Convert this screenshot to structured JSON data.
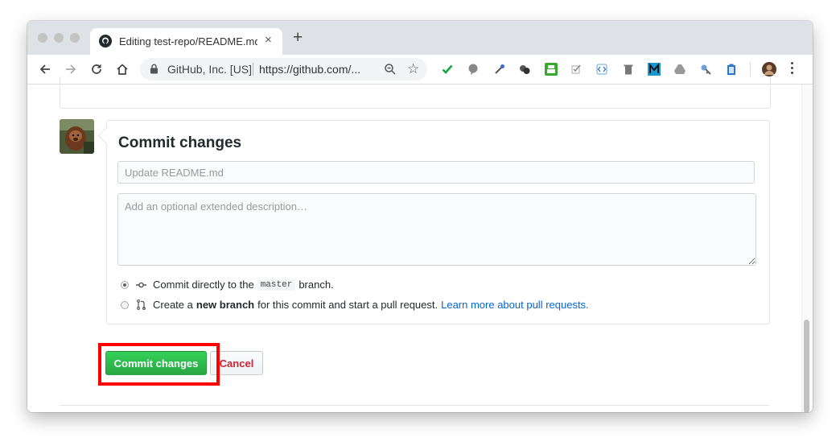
{
  "browser": {
    "tab_title": "Editing test-repo/README.md",
    "close_tab": "×",
    "new_tab": "+",
    "site_identity": "GitHub, Inc. [US]",
    "url": "https://github.com/...",
    "extensions": [
      "check-icon",
      "bubble-icon",
      "eyedropper-icon",
      "circles-icon",
      "printer-icon",
      "checkbox-icon",
      "code-icon",
      "trash-icon",
      "m-icon",
      "drive-icon",
      "key-icon",
      "clipboard-icon",
      "profile-avatar"
    ]
  },
  "commit": {
    "heading": "Commit changes",
    "summary_placeholder": "Update README.md",
    "description_placeholder": "Add an optional extended description…",
    "option_direct": {
      "prefix": "Commit directly to the",
      "branch": "master",
      "suffix": "branch."
    },
    "option_new_branch": {
      "prefix": "Create a",
      "bold": "new branch",
      "suffix": "for this commit and start a pull request.",
      "link": "Learn more about pull requests."
    },
    "selected_option": "direct",
    "commit_button": "Commit changes",
    "cancel_button": "Cancel"
  },
  "colors": {
    "commit_green": "#28a745",
    "cancel_red": "#cb2431",
    "link_blue": "#0366d6",
    "highlight_red": "#ff0000"
  }
}
